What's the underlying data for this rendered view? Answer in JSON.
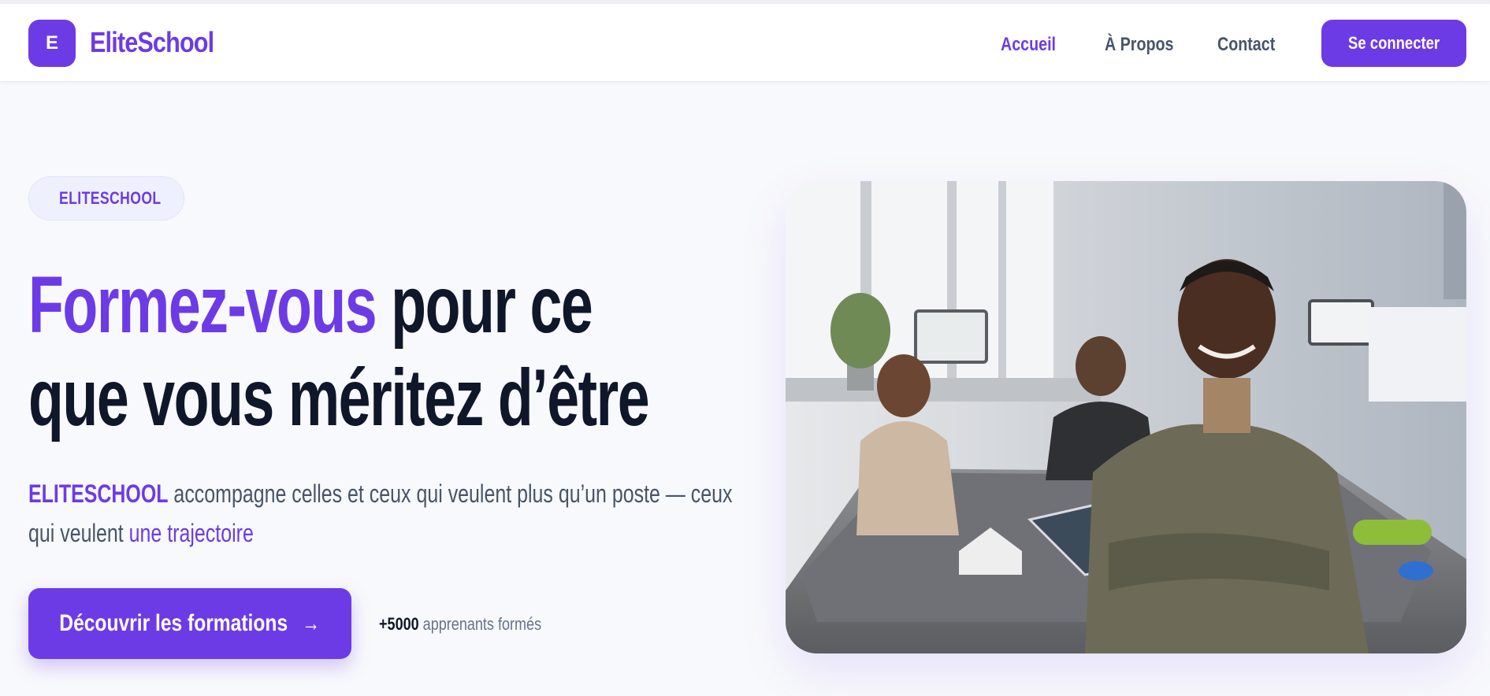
{
  "header": {
    "logo_letter": "E",
    "logo_text": "EliteSchool",
    "nav": [
      {
        "label": "Accueil",
        "active": true
      },
      {
        "label": "À Propos",
        "active": false
      },
      {
        "label": "Contact",
        "active": false
      }
    ],
    "login_label": "Se connecter"
  },
  "hero": {
    "badge": "ELITESCHOOL",
    "headline": {
      "accent": "Formez-vous",
      "line1_rest": " pour ce",
      "line2": "que vous méritez d’être"
    },
    "description": {
      "brand": "ELITESCHOOL",
      "line1_rest": " accompagne celles et ceux qui veulent plus qu’un poste — ceux",
      "line2_prefix": "qui veulent ",
      "line2_link": "une trajectoire"
    },
    "cta_label": "Découvrir les formations",
    "cta_icon": "arrow-right-icon",
    "stat": {
      "number": "+5000",
      "label": " apprenants formés"
    },
    "image_alt": "hero-photo"
  },
  "colors": {
    "accent": "#6d3be5",
    "heading": "#0f172a",
    "body_text": "#475569",
    "background": "#f8f9fc"
  }
}
